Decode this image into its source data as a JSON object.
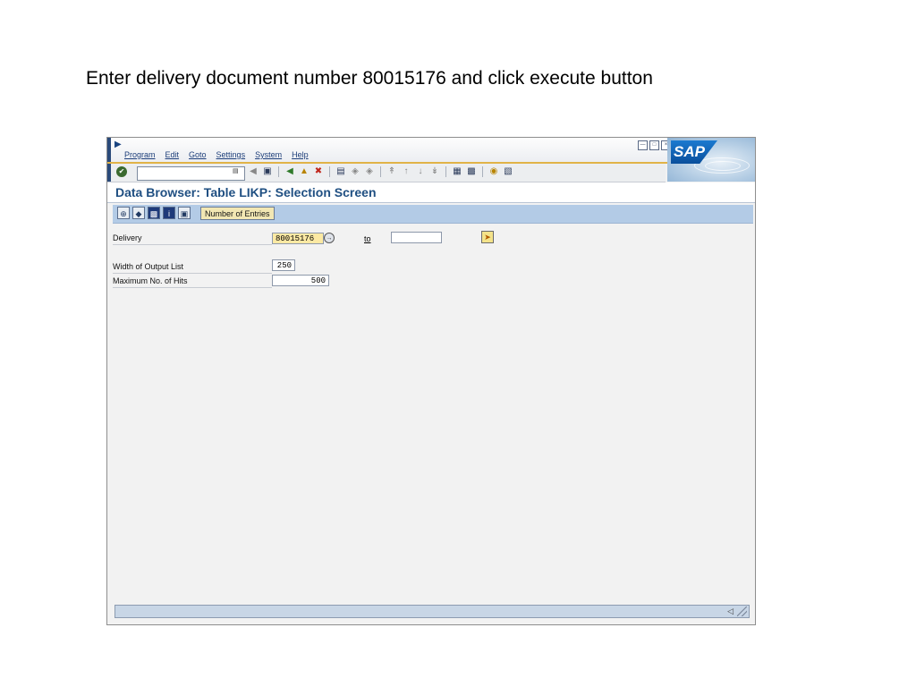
{
  "instruction": "Enter delivery document number 80015176 and click execute button",
  "menu": {
    "items": [
      "Program",
      "Edit",
      "Goto",
      "Settings",
      "System",
      "Help"
    ]
  },
  "window_buttons": [
    "minimize",
    "maximize",
    "close"
  ],
  "logo": {
    "text": "SAP",
    "color": "#0a4f9c"
  },
  "command_field": {
    "value": ""
  },
  "screen_title": "Data Browser: Table LIKP: Selection Screen",
  "app_toolbar": {
    "icons": [
      "execute-icon",
      "get-variant-icon",
      "save-variant-icon",
      "info-icon",
      "selection-options-icon"
    ],
    "number_of_entries_label": "Number of Entries"
  },
  "selection": {
    "delivery_label": "Delivery",
    "delivery_value": "80015176",
    "to_label": "to",
    "to_value": ""
  },
  "settings": {
    "width_label": "Width of Output List",
    "width_value": "250",
    "max_hits_label": "Maximum No. of Hits",
    "max_hits_value": "500"
  },
  "colors": {
    "title": "#1f4f82",
    "app_toolbar": "#b3cbe6",
    "required_field": "#fce9a3",
    "accent_line": "#e1b347"
  }
}
